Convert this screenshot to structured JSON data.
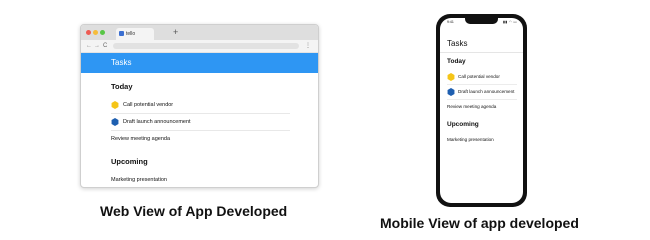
{
  "web": {
    "tab_title": "tello",
    "new_tab": "+",
    "nav_back": "←",
    "nav_forward": "→",
    "nav_reload": "C",
    "menu": "⋮",
    "header_title": "Tasks",
    "sections": [
      {
        "title": "Today",
        "items": [
          {
            "label": "Call potential vendor",
            "icon": "yellow-hexagon-icon"
          },
          {
            "label": "Draft launch announcement",
            "icon": "blue-hexagon-icon"
          },
          {
            "label": "Review meeting agenda",
            "icon": null
          }
        ]
      },
      {
        "title": "Upcoming",
        "items": [
          {
            "label": "Marketing presentation",
            "icon": null
          }
        ]
      }
    ],
    "caption": "Web View of App Developed"
  },
  "mobile": {
    "time": "9:41",
    "status_icons": "▮▮ ◠ ▭",
    "header_title": "Tasks",
    "sections": [
      {
        "title": "Today",
        "items": [
          {
            "label": "Call potential vendor",
            "icon": "yellow-hexagon-icon"
          },
          {
            "label": "Draft launch announcement",
            "icon": "blue-hexagon-icon"
          },
          {
            "label": "Review meeting agenda",
            "icon": null
          }
        ]
      },
      {
        "title": "Upcoming",
        "items": [
          {
            "label": "Marketing presentation",
            "icon": null
          }
        ]
      }
    ],
    "caption": "Mobile View of app developed"
  },
  "colors": {
    "header_blue": "#2e96f3",
    "hex_yellow": "#f5c518",
    "hex_blue": "#1e5fb0"
  }
}
